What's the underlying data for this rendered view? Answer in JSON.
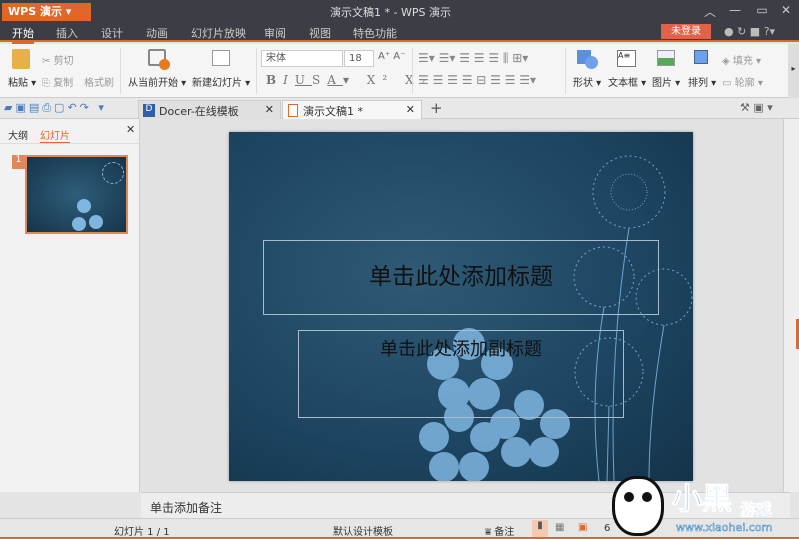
{
  "app": {
    "button_label": "WPS 演示",
    "title": "演示文稿1 * - WPS 演示",
    "login_label": "未登录"
  },
  "menu": [
    "开始",
    "插入",
    "设计",
    "动画",
    "幻灯片放映",
    "审阅",
    "视图",
    "特色功能"
  ],
  "ribbon": {
    "paste": "粘贴",
    "cut": "剪切",
    "copy": "复制",
    "format_painter": "格式刷",
    "play_from_current": "从当前开始",
    "new_slide": "新建幻灯片",
    "font_name": "宋体",
    "font_size": "18",
    "shape": "形状",
    "textbox": "文本框",
    "picture": "图片",
    "arrange": "排列",
    "fill": "填充",
    "outline": "轮廓"
  },
  "tabs": [
    {
      "label": "Docer-在线模板"
    },
    {
      "label": "演示文稿1 *"
    }
  ],
  "left_panel": {
    "tabs": [
      "大纲",
      "幻灯片"
    ],
    "slide_number": "1"
  },
  "slide": {
    "title_placeholder": "单击此处添加标题",
    "subtitle_placeholder": "单击此处添加副标题"
  },
  "notes_placeholder": "单击添加备注",
  "status": {
    "slide_count": "幻灯片 1 / 1",
    "template": "默认设计模板",
    "notes_label": "备注",
    "zoom": "6"
  },
  "watermark": {
    "text": "小黑游戏",
    "url": "www.xiaohei.com"
  },
  "colors": {
    "accent": "#e0662a",
    "titlebar": "#3b3e45",
    "slide_bg": "#1d4460",
    "flower": "#7fb6e0"
  }
}
